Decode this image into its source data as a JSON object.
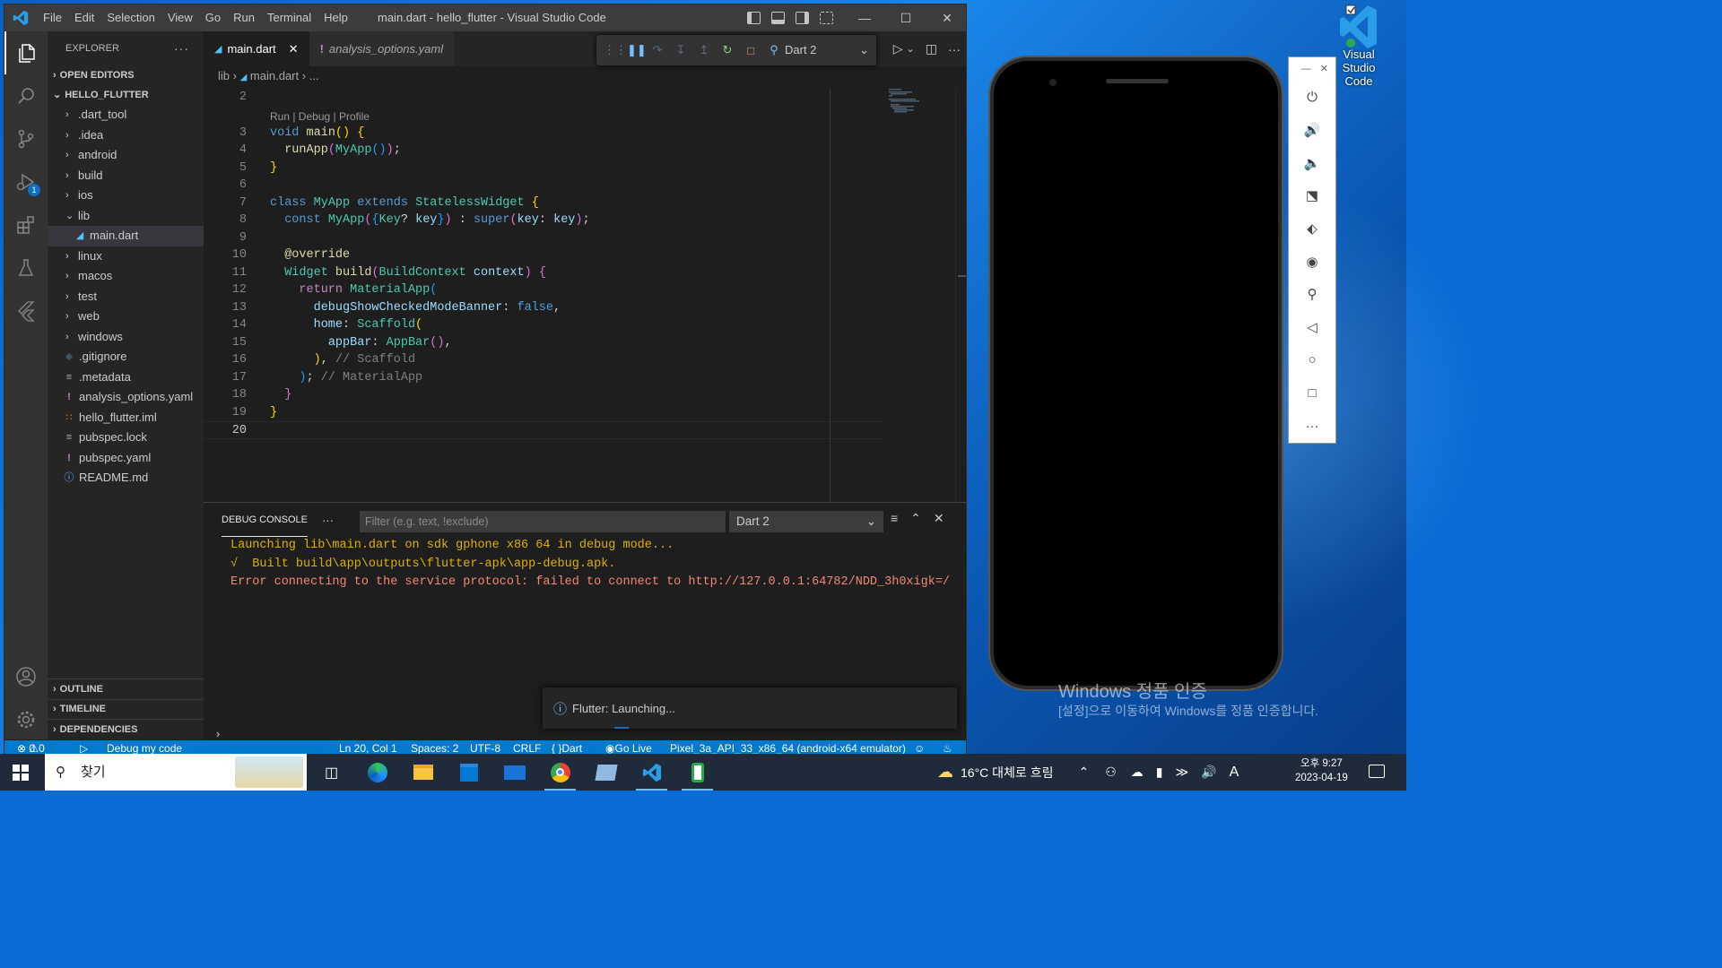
{
  "window": {
    "title": "main.dart - hello_flutter - Visual Studio Code"
  },
  "menu": [
    "File",
    "Edit",
    "Selection",
    "View",
    "Go",
    "Run",
    "Terminal",
    "Help"
  ],
  "activity": {
    "debug_badge": "1"
  },
  "explorer": {
    "header": "EXPLORER",
    "open_editors": "OPEN EDITORS",
    "project": "HELLO_FLUTTER",
    "items": [
      {
        "label": ".dart_tool",
        "kind": "folder"
      },
      {
        "label": ".idea",
        "kind": "folder"
      },
      {
        "label": "android",
        "kind": "folder"
      },
      {
        "label": "build",
        "kind": "folder"
      },
      {
        "label": "ios",
        "kind": "folder"
      },
      {
        "label": "lib",
        "kind": "folder-open"
      },
      {
        "label": "main.dart",
        "kind": "dart-child"
      },
      {
        "label": "linux",
        "kind": "folder"
      },
      {
        "label": "macos",
        "kind": "folder"
      },
      {
        "label": "test",
        "kind": "folder"
      },
      {
        "label": "web",
        "kind": "folder"
      },
      {
        "label": "windows",
        "kind": "folder"
      },
      {
        "label": ".gitignore",
        "kind": "git"
      },
      {
        "label": ".metadata",
        "kind": "text"
      },
      {
        "label": "analysis_options.yaml",
        "kind": "yaml"
      },
      {
        "label": "hello_flutter.iml",
        "kind": "rss"
      },
      {
        "label": "pubspec.lock",
        "kind": "text"
      },
      {
        "label": "pubspec.yaml",
        "kind": "yaml"
      },
      {
        "label": "README.md",
        "kind": "info"
      }
    ],
    "outline": "OUTLINE",
    "timeline": "TIMELINE",
    "dependencies": "DEPENDENCIES"
  },
  "tabs": [
    {
      "label": "main.dart",
      "active": true
    },
    {
      "label": "analysis_options.yaml",
      "active": false
    }
  ],
  "debug_toolbar": {
    "config": "Dart 2"
  },
  "breadcrumb": {
    "folder": "lib",
    "file": "main.dart",
    "rest": "..."
  },
  "editor": {
    "codelens": "Run | Debug | Profile",
    "line_numbers": [
      "2",
      "3",
      "4",
      "5",
      "6",
      "7",
      "8",
      "9",
      "10",
      "11",
      "12",
      "13",
      "14",
      "15",
      "16",
      "17",
      "18",
      "19",
      "20"
    ]
  },
  "panel": {
    "tab": "DEBUG CONSOLE",
    "filter_placeholder": "Filter (e.g. text, !exclude)",
    "config": "Dart 2",
    "lines": [
      "Launching lib\\main.dart on sdk gphone x86 64 in debug mode...",
      "√  Built build\\app\\outputs\\flutter-apk\\app-debug.apk.",
      "Error connecting to the service protocol: failed to connect to http://127.0.0.1:64782/NDD_3h0xigk=/"
    ]
  },
  "toast": {
    "text": "Flutter: Launching..."
  },
  "status": {
    "errors": "0",
    "warnings": "0",
    "debug": "Debug my code",
    "position": "Ln 20, Col 1",
    "spaces": "Spaces: 2",
    "encoding": "UTF-8",
    "eol": "CRLF",
    "language": "Dart",
    "golive": "Go Live",
    "device": "Pixel_3a_API_33_x86_64 (android-x64 emulator)"
  },
  "desktop": {
    "icon_label_1": "Visual Studio",
    "icon_label_2": "Code",
    "activation_title": "Windows 정품 인증",
    "activation_sub": "[설정]으로 이동하여 Windows를 정품 인증합니다."
  },
  "taskbar": {
    "search": "찾기",
    "weather": "16°C  대체로 흐림",
    "ime": "A",
    "time": "오후 9:27",
    "date": "2023-04-19"
  }
}
